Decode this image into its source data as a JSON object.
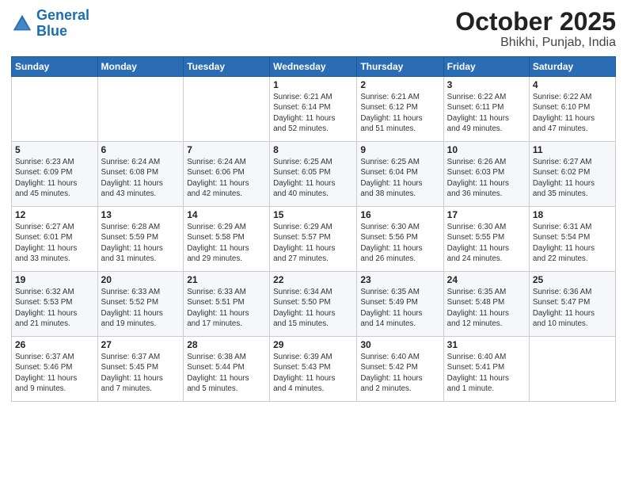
{
  "header": {
    "logo_line1": "General",
    "logo_line2": "Blue",
    "title": "October 2025",
    "subtitle": "Bhikhi, Punjab, India"
  },
  "weekdays": [
    "Sunday",
    "Monday",
    "Tuesday",
    "Wednesday",
    "Thursday",
    "Friday",
    "Saturday"
  ],
  "weeks": [
    [
      {
        "day": "",
        "info": ""
      },
      {
        "day": "",
        "info": ""
      },
      {
        "day": "",
        "info": ""
      },
      {
        "day": "1",
        "info": "Sunrise: 6:21 AM\nSunset: 6:14 PM\nDaylight: 11 hours\nand 52 minutes."
      },
      {
        "day": "2",
        "info": "Sunrise: 6:21 AM\nSunset: 6:12 PM\nDaylight: 11 hours\nand 51 minutes."
      },
      {
        "day": "3",
        "info": "Sunrise: 6:22 AM\nSunset: 6:11 PM\nDaylight: 11 hours\nand 49 minutes."
      },
      {
        "day": "4",
        "info": "Sunrise: 6:22 AM\nSunset: 6:10 PM\nDaylight: 11 hours\nand 47 minutes."
      }
    ],
    [
      {
        "day": "5",
        "info": "Sunrise: 6:23 AM\nSunset: 6:09 PM\nDaylight: 11 hours\nand 45 minutes."
      },
      {
        "day": "6",
        "info": "Sunrise: 6:24 AM\nSunset: 6:08 PM\nDaylight: 11 hours\nand 43 minutes."
      },
      {
        "day": "7",
        "info": "Sunrise: 6:24 AM\nSunset: 6:06 PM\nDaylight: 11 hours\nand 42 minutes."
      },
      {
        "day": "8",
        "info": "Sunrise: 6:25 AM\nSunset: 6:05 PM\nDaylight: 11 hours\nand 40 minutes."
      },
      {
        "day": "9",
        "info": "Sunrise: 6:25 AM\nSunset: 6:04 PM\nDaylight: 11 hours\nand 38 minutes."
      },
      {
        "day": "10",
        "info": "Sunrise: 6:26 AM\nSunset: 6:03 PM\nDaylight: 11 hours\nand 36 minutes."
      },
      {
        "day": "11",
        "info": "Sunrise: 6:27 AM\nSunset: 6:02 PM\nDaylight: 11 hours\nand 35 minutes."
      }
    ],
    [
      {
        "day": "12",
        "info": "Sunrise: 6:27 AM\nSunset: 6:01 PM\nDaylight: 11 hours\nand 33 minutes."
      },
      {
        "day": "13",
        "info": "Sunrise: 6:28 AM\nSunset: 5:59 PM\nDaylight: 11 hours\nand 31 minutes."
      },
      {
        "day": "14",
        "info": "Sunrise: 6:29 AM\nSunset: 5:58 PM\nDaylight: 11 hours\nand 29 minutes."
      },
      {
        "day": "15",
        "info": "Sunrise: 6:29 AM\nSunset: 5:57 PM\nDaylight: 11 hours\nand 27 minutes."
      },
      {
        "day": "16",
        "info": "Sunrise: 6:30 AM\nSunset: 5:56 PM\nDaylight: 11 hours\nand 26 minutes."
      },
      {
        "day": "17",
        "info": "Sunrise: 6:30 AM\nSunset: 5:55 PM\nDaylight: 11 hours\nand 24 minutes."
      },
      {
        "day": "18",
        "info": "Sunrise: 6:31 AM\nSunset: 5:54 PM\nDaylight: 11 hours\nand 22 minutes."
      }
    ],
    [
      {
        "day": "19",
        "info": "Sunrise: 6:32 AM\nSunset: 5:53 PM\nDaylight: 11 hours\nand 21 minutes."
      },
      {
        "day": "20",
        "info": "Sunrise: 6:33 AM\nSunset: 5:52 PM\nDaylight: 11 hours\nand 19 minutes."
      },
      {
        "day": "21",
        "info": "Sunrise: 6:33 AM\nSunset: 5:51 PM\nDaylight: 11 hours\nand 17 minutes."
      },
      {
        "day": "22",
        "info": "Sunrise: 6:34 AM\nSunset: 5:50 PM\nDaylight: 11 hours\nand 15 minutes."
      },
      {
        "day": "23",
        "info": "Sunrise: 6:35 AM\nSunset: 5:49 PM\nDaylight: 11 hours\nand 14 minutes."
      },
      {
        "day": "24",
        "info": "Sunrise: 6:35 AM\nSunset: 5:48 PM\nDaylight: 11 hours\nand 12 minutes."
      },
      {
        "day": "25",
        "info": "Sunrise: 6:36 AM\nSunset: 5:47 PM\nDaylight: 11 hours\nand 10 minutes."
      }
    ],
    [
      {
        "day": "26",
        "info": "Sunrise: 6:37 AM\nSunset: 5:46 PM\nDaylight: 11 hours\nand 9 minutes."
      },
      {
        "day": "27",
        "info": "Sunrise: 6:37 AM\nSunset: 5:45 PM\nDaylight: 11 hours\nand 7 minutes."
      },
      {
        "day": "28",
        "info": "Sunrise: 6:38 AM\nSunset: 5:44 PM\nDaylight: 11 hours\nand 5 minutes."
      },
      {
        "day": "29",
        "info": "Sunrise: 6:39 AM\nSunset: 5:43 PM\nDaylight: 11 hours\nand 4 minutes."
      },
      {
        "day": "30",
        "info": "Sunrise: 6:40 AM\nSunset: 5:42 PM\nDaylight: 11 hours\nand 2 minutes."
      },
      {
        "day": "31",
        "info": "Sunrise: 6:40 AM\nSunset: 5:41 PM\nDaylight: 11 hours\nand 1 minute."
      },
      {
        "day": "",
        "info": ""
      }
    ]
  ]
}
